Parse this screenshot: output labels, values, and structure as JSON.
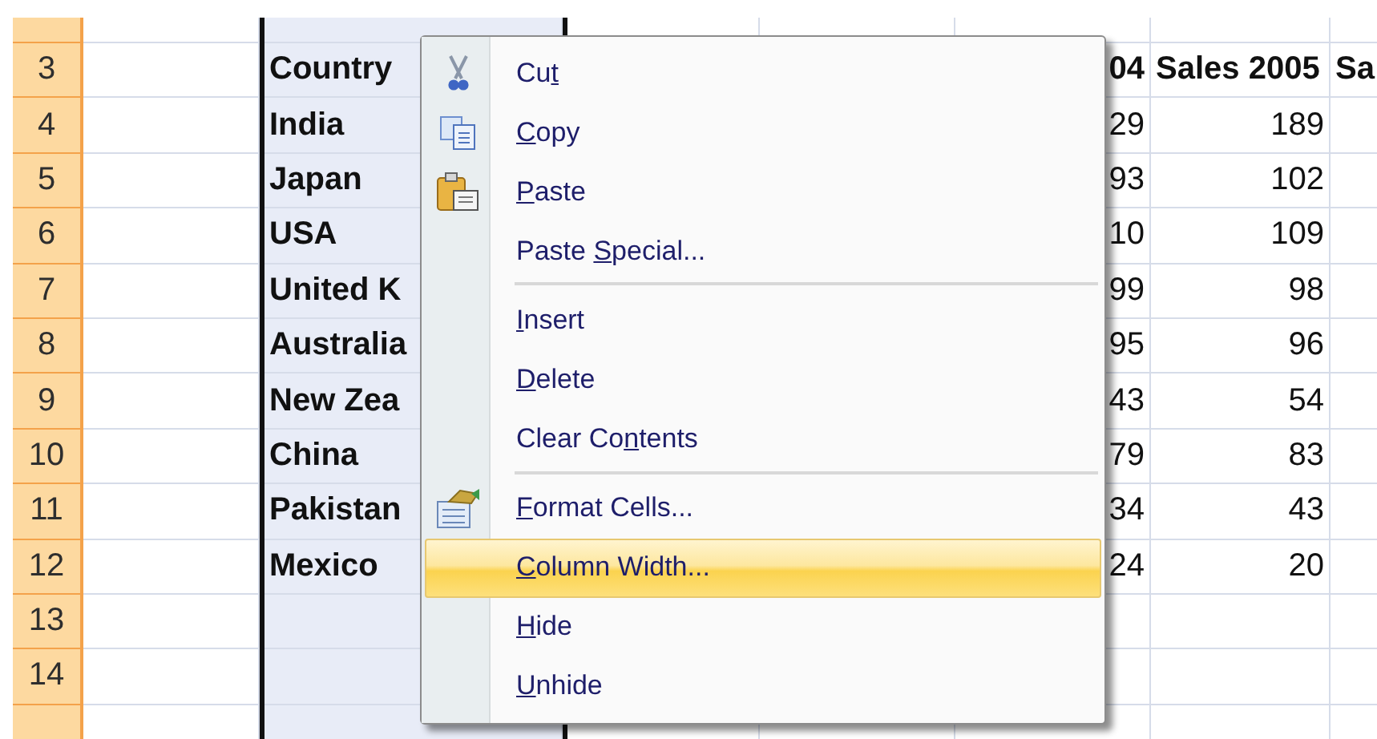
{
  "sheet": {
    "columns": [
      {
        "selected": false
      },
      {
        "selected": true
      },
      {
        "selected": false
      },
      {
        "selected": false
      },
      {
        "selected": false
      },
      {
        "selected": false
      },
      {
        "selected": false
      }
    ],
    "rows": [
      {
        "header": "3",
        "kind": "header",
        "b": "Country",
        "e": "04",
        "f": "Sales 2005",
        "g": "Sa"
      },
      {
        "header": "4",
        "kind": "data",
        "b": "India",
        "e": "29",
        "f": "189"
      },
      {
        "header": "5",
        "kind": "data",
        "b": "Japan",
        "e": "93",
        "f": "102"
      },
      {
        "header": "6",
        "kind": "data",
        "b": "USA",
        "e": "10",
        "f": "109"
      },
      {
        "header": "7",
        "kind": "data",
        "b": "United K",
        "e": "99",
        "f": "98"
      },
      {
        "header": "8",
        "kind": "data",
        "b": "Australia",
        "e": "95",
        "f": "96"
      },
      {
        "header": "9",
        "kind": "data",
        "b": "New Zea",
        "e": "43",
        "f": "54"
      },
      {
        "header": "10",
        "kind": "data",
        "b": "China",
        "e": "79",
        "f": "83"
      },
      {
        "header": "11",
        "kind": "data",
        "b": "Pakistan",
        "e": "34",
        "f": "43"
      },
      {
        "header": "12",
        "kind": "data",
        "b": "Mexico",
        "e": "24",
        "f": "20"
      },
      {
        "header": "13",
        "kind": "data"
      },
      {
        "header": "14",
        "kind": "data"
      }
    ]
  },
  "context_menu": {
    "items": [
      {
        "kind": "item",
        "segments": [
          {
            "text": "Cu"
          },
          {
            "text": "t",
            "underline": true
          }
        ],
        "selected": false
      },
      {
        "kind": "item",
        "segments": [
          {
            "text": "C",
            "underline": true
          },
          {
            "text": "opy"
          }
        ],
        "selected": false
      },
      {
        "kind": "item",
        "segments": [
          {
            "text": "P",
            "underline": true
          },
          {
            "text": "aste"
          }
        ],
        "selected": false
      },
      {
        "kind": "item",
        "segments": [
          {
            "text": "Paste "
          },
          {
            "text": "S",
            "underline": true
          },
          {
            "text": "pecial..."
          }
        ],
        "selected": false
      },
      {
        "kind": "separator"
      },
      {
        "kind": "item",
        "segments": [
          {
            "text": "I",
            "underline": true
          },
          {
            "text": "nsert"
          }
        ],
        "selected": false
      },
      {
        "kind": "item",
        "segments": [
          {
            "text": "D",
            "underline": true
          },
          {
            "text": "elete"
          }
        ],
        "selected": false
      },
      {
        "kind": "item",
        "segments": [
          {
            "text": "Clear Co"
          },
          {
            "text": "n",
            "underline": true
          },
          {
            "text": "tents"
          }
        ],
        "selected": false
      },
      {
        "kind": "separator"
      },
      {
        "kind": "item",
        "segments": [
          {
            "text": "F",
            "underline": true
          },
          {
            "text": "ormat Cells..."
          }
        ],
        "selected": false
      },
      {
        "kind": "item",
        "segments": [
          {
            "text": "C",
            "underline": true
          },
          {
            "text": "olumn Width..."
          }
        ],
        "selected": true
      },
      {
        "kind": "item",
        "segments": [
          {
            "text": "H",
            "underline": true
          },
          {
            "text": "ide"
          }
        ],
        "selected": false
      },
      {
        "kind": "item",
        "segments": [
          {
            "text": "U",
            "underline": true
          },
          {
            "text": "nhide"
          }
        ],
        "selected": false
      }
    ]
  }
}
